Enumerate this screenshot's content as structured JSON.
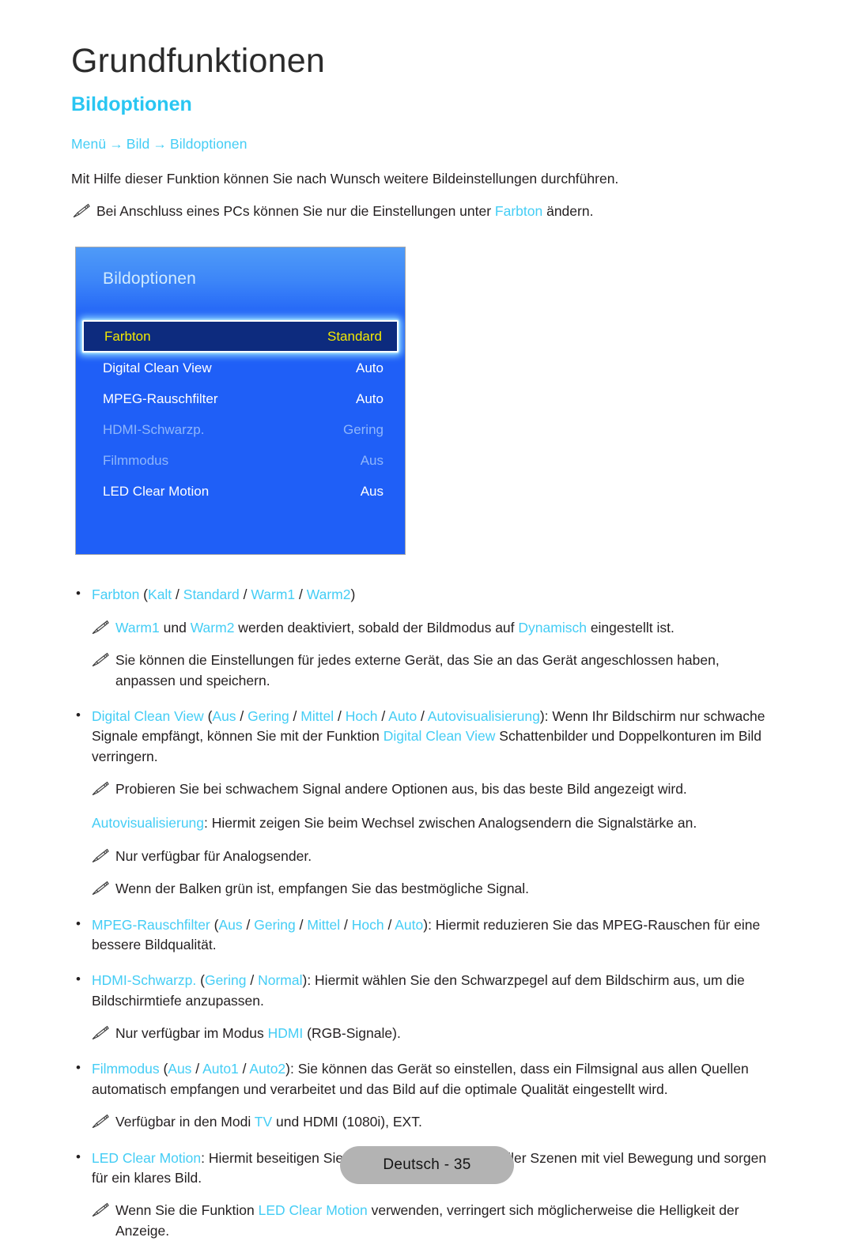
{
  "header": {
    "chapter_title": "Grundfunktionen",
    "section_title": "Bildoptionen",
    "breadcrumb": {
      "items": [
        "Menü",
        "Bild",
        "Bildoptionen"
      ],
      "separator": "→"
    },
    "intro": "Mit Hilfe dieser Funktion können Sie nach Wunsch weitere Bildeinstellungen durchführen.",
    "intro_note": {
      "icon": "pencil-note-icon",
      "pre": "Bei Anschluss eines PCs können Sie nur die Einstellungen unter ",
      "link": "Farbton",
      "post": " ändern."
    }
  },
  "osd": {
    "title": "Bildoptionen",
    "rows": [
      {
        "label": "Farbton",
        "value": "Standard",
        "state": "selected"
      },
      {
        "label": "Digital Clean View",
        "value": "Auto",
        "state": "normal"
      },
      {
        "label": "MPEG-Rauschfilter",
        "value": "Auto",
        "state": "normal"
      },
      {
        "label": "HDMI-Schwarzp.",
        "value": "Gering",
        "state": "disabled"
      },
      {
        "label": "Filmmodus",
        "value": "Aus",
        "state": "disabled"
      },
      {
        "label": "LED Clear Motion",
        "value": "Aus",
        "state": "normal"
      }
    ]
  },
  "body": {
    "farbton_bullet": {
      "name": "Farbton",
      "options_open": " (",
      "options": [
        "Kalt",
        "Standard",
        "Warm1",
        "Warm2"
      ],
      "options_sep": " / ",
      "options_close": ")"
    },
    "note_warm": {
      "p1": "Warm1",
      "t1": " und ",
      "p2": "Warm2",
      "t2": " werden deaktiviert, sobald der Bildmodus auf ",
      "p3": "Dynamisch",
      "t3": " eingestellt ist."
    },
    "note_extern": "Sie können die Einstellungen für jedes externe Gerät, das Sie an das Gerät angeschlossen haben, anpassen und speichern.",
    "dcv_bullet": {
      "name": "Digital Clean View",
      "options": [
        "Aus",
        "Gering",
        "Mittel",
        "Hoch",
        "Auto",
        "Autovisualisierung"
      ],
      "text_a": ": Wenn Ihr Bildschirm nur schwache Signale empfängt, können Sie mit der Funktion ",
      "link_b": "Digital Clean View",
      "text_c": " Schattenbilder und Doppelkonturen im Bild verringern."
    },
    "note_probieren": "Probieren Sie bei schwachem Signal andere Optionen aus, bis das beste Bild angezeigt wird.",
    "autovis": {
      "link": "Autovisualisierung",
      "text": ": Hiermit zeigen Sie beim Wechsel zwischen Analogsendern die Signalstärke an."
    },
    "note_analog": "Nur verfügbar für Analogsender.",
    "note_balken": "Wenn der Balken grün ist, empfangen Sie das bestmögliche Signal.",
    "mpeg_bullet": {
      "name": "MPEG-Rauschfilter",
      "options": [
        "Aus",
        "Gering",
        "Mittel",
        "Hoch",
        "Auto"
      ],
      "text": ": Hiermit reduzieren Sie das MPEG-Rauschen für eine bessere Bildqualität."
    },
    "hdmi_bullet": {
      "name": "HDMI-Schwarzp.",
      "options": [
        "Gering",
        "Normal"
      ],
      "text": ": Hiermit wählen Sie den Schwarzpegel auf dem Bildschirm aus, um die Bildschirmtiefe anzupassen."
    },
    "note_hdmi": {
      "pre": "Nur verfügbar im Modus ",
      "link": "HDMI",
      "post": " (RGB-Signale)."
    },
    "film_bullet": {
      "name": "Filmmodus",
      "options": [
        "Aus",
        "Auto1",
        "Auto2"
      ],
      "text": ": Sie können das Gerät so einstellen, dass ein Filmsignal aus allen Quellen automatisch empfangen und verarbeitet und das Bild auf die optimale Qualität eingestellt wird."
    },
    "note_film": {
      "pre": "Verfügbar in den Modi ",
      "link": "TV",
      "post": " und HDMI (1080i), EXT."
    },
    "led_bullet": {
      "name": "LED Clear Motion",
      "text": ": Hiermit beseitigen Sie das Verschwimmen schneller Szenen mit viel Bewegung und sorgen für ein klares Bild."
    },
    "note_led": {
      "pre": "Wenn Sie die Funktion ",
      "link": "LED Clear Motion",
      "post": " verwenden, verringert sich möglicherweise die Helligkeit der Anzeige."
    }
  },
  "footer": {
    "page_label": "Deutsch - 35"
  },
  "colors": {
    "accent_cyan": "#44cdf5",
    "section_cyan": "#29c6f2",
    "osd_blue": "#1f5ff7",
    "osd_selected_bg": "#0d2b7e",
    "osd_selected_text": "#f3e900",
    "footer_badge": "#b3b3b3"
  }
}
